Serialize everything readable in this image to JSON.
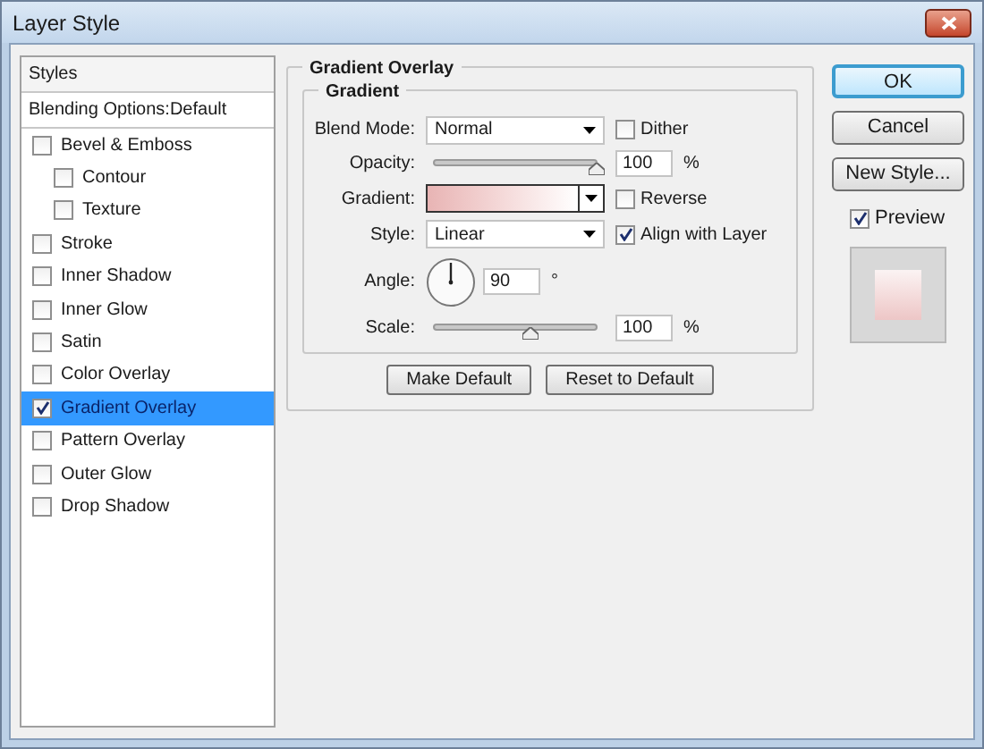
{
  "window": {
    "title": "Layer Style"
  },
  "sidebar": {
    "header": "Styles",
    "blending": "Blending Options:Default",
    "items": [
      {
        "label": "Bevel & Emboss",
        "checked": false,
        "selected": false,
        "children": [
          {
            "label": "Contour",
            "checked": false,
            "selected": false
          },
          {
            "label": "Texture",
            "checked": false,
            "selected": false
          }
        ]
      },
      {
        "label": "Stroke",
        "checked": false,
        "selected": false
      },
      {
        "label": "Inner Shadow",
        "checked": false,
        "selected": false
      },
      {
        "label": "Inner Glow",
        "checked": false,
        "selected": false
      },
      {
        "label": "Satin",
        "checked": false,
        "selected": false
      },
      {
        "label": "Color Overlay",
        "checked": false,
        "selected": false
      },
      {
        "label": "Gradient Overlay",
        "checked": true,
        "selected": true
      },
      {
        "label": "Pattern Overlay",
        "checked": false,
        "selected": false
      },
      {
        "label": "Outer Glow",
        "checked": false,
        "selected": false
      },
      {
        "label": "Drop Shadow",
        "checked": false,
        "selected": false
      }
    ]
  },
  "panel": {
    "title": "Gradient Overlay",
    "group": "Gradient",
    "blend_mode": {
      "label": "Blend Mode:",
      "value": "Normal"
    },
    "dither": {
      "label": "Dither",
      "checked": false
    },
    "opacity": {
      "label": "Opacity:",
      "level": 1.0,
      "value": "100",
      "unit": "%"
    },
    "gradient": {
      "label": "Gradient:"
    },
    "reverse": {
      "label": "Reverse",
      "checked": false
    },
    "style": {
      "label": "Style:",
      "value": "Linear"
    },
    "align": {
      "label": "Align with Layer",
      "checked": true
    },
    "angle": {
      "label": "Angle:",
      "value": "90",
      "unit": "°"
    },
    "scale": {
      "label": "Scale:",
      "level": 0.6,
      "value": "100",
      "unit": "%"
    },
    "buttons": [
      "Make Default",
      "Reset to Default"
    ]
  },
  "actions": {
    "buttons": [
      {
        "label": "OK",
        "default": true
      },
      {
        "label": "Cancel",
        "default": false
      },
      {
        "label": "New Style...",
        "default": false
      }
    ],
    "preview": {
      "label": "Preview",
      "checked": true
    }
  }
}
